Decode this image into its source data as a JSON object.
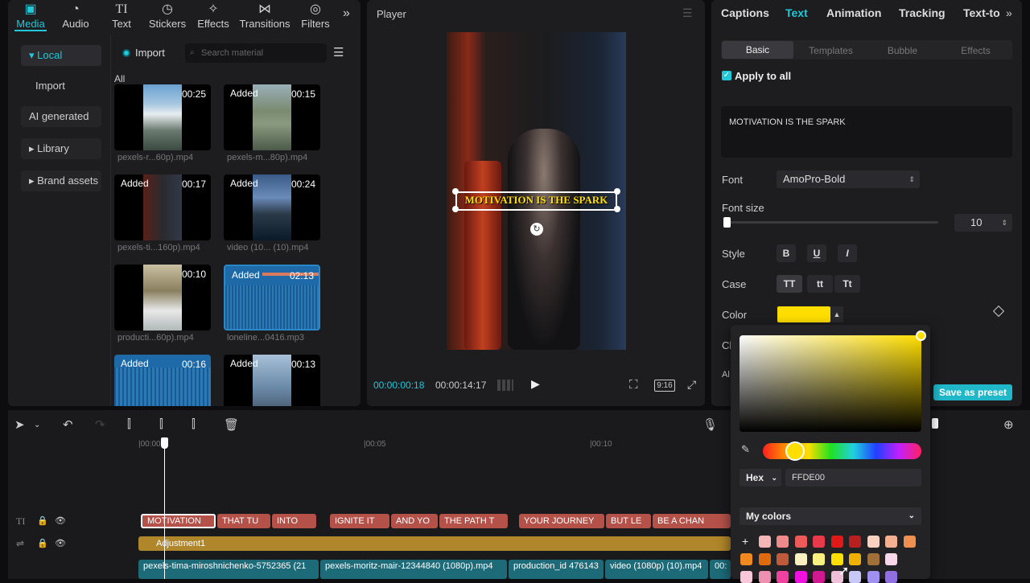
{
  "toolbar": {
    "tabs": [
      {
        "label": "Media",
        "icon": "media-icon"
      },
      {
        "label": "Audio",
        "icon": "audio-icon"
      },
      {
        "label": "Text",
        "icon": "text-icon"
      },
      {
        "label": "Stickers",
        "icon": "stickers-icon"
      },
      {
        "label": "Effects",
        "icon": "effects-icon"
      },
      {
        "label": "Transitions",
        "icon": "transitions-icon"
      },
      {
        "label": "Filters",
        "icon": "filters-icon"
      }
    ],
    "more": "»"
  },
  "sidebar": {
    "items": [
      {
        "label": "▾ Local"
      },
      {
        "label": "Import"
      },
      {
        "label": "AI generated"
      },
      {
        "label": "▸ Library"
      },
      {
        "label": "▸ Brand assets"
      }
    ]
  },
  "media": {
    "import_label": "Import",
    "search_placeholder": "Search material",
    "all_label": "All",
    "items": [
      {
        "badge": "",
        "duration": "00:25",
        "name": "pexels-r...60p).mp4"
      },
      {
        "badge": "Added",
        "duration": "00:15",
        "name": "pexels-m...80p).mp4"
      },
      {
        "badge": "Added",
        "duration": "00:17",
        "name": "pexels-ti...160p).mp4"
      },
      {
        "badge": "Added",
        "duration": "00:24",
        "name": "video (10... (10).mp4"
      },
      {
        "badge": "",
        "duration": "00:10",
        "name": "producti...60p).mp4"
      },
      {
        "badge": "Added",
        "duration": "02:13",
        "name": "loneline...0416.mp3"
      },
      {
        "badge": "Added",
        "duration": "00:16",
        "name": ""
      },
      {
        "badge": "Added",
        "duration": "00:13",
        "name": ""
      }
    ]
  },
  "player": {
    "title": "Player",
    "caption": "MOTIVATION IS THE SPARK",
    "current_time": "00:00:00:18",
    "total_time": "00:00:14:17",
    "ratio": "9:16"
  },
  "inspector": {
    "tabs": [
      "Captions",
      "Text",
      "Animation",
      "Tracking",
      "Text-to"
    ],
    "subtabs": [
      "Basic",
      "Templates",
      "Bubble",
      "Effects"
    ],
    "apply_all": "Apply to all",
    "text_value": "MOTIVATION IS THE SPARK",
    "font_label": "Font",
    "font_value": "AmoPro-Bold",
    "font_size_label": "Font size",
    "font_size_value": "10",
    "style_label": "Style",
    "style_buttons": [
      "B",
      "U",
      "I"
    ],
    "case_label": "Case",
    "case_buttons": [
      "TT",
      "tt",
      "Tt"
    ],
    "color_label": "Color",
    "color_value": "#FFDE00",
    "cut_labels": [
      "Cl",
      "Al"
    ],
    "save_preset": "Save as preset"
  },
  "color_picker": {
    "mode": "Hex",
    "hex": "FFDE00",
    "my_colors": "My colors",
    "add": "+",
    "swatches_row1": [
      "#f4b6b6",
      "#f08a8a",
      "#ec5a5a",
      "#e83a4a",
      "#e01818",
      "#b82020",
      "#f8d2c0",
      "#f4b090",
      "#f09050"
    ],
    "swatches_row2": [
      "#f08a20",
      "#e06a10",
      "#c05a3a",
      "#f8f0c0",
      "#f8f080",
      "#ffde00",
      "#f0b000",
      "#a07038",
      "#f8d8e8"
    ],
    "swatches_row3": [
      "#f8c8d8",
      "#f090b0",
      "#f040a0",
      "#f010e0",
      "#d01890",
      "#f0c0d8",
      "#c8c8f8",
      "#a090f0",
      "#9070e0"
    ]
  },
  "timeline": {
    "ticks": [
      "|00:00",
      "|00:05",
      "|00:10"
    ],
    "text_clips": [
      "MOTIVATION",
      "THAT TU",
      "INTO",
      "IGNITE IT",
      "AND YO",
      "THE PATH T",
      "YOUR JOURNEY",
      "BUT LE",
      "BE A CHAN"
    ],
    "adjustment": "Adjustment1",
    "video_clips": [
      "pexels-tima-miroshnichenko-5752365 (21",
      "pexels-moritz-mair-12344840 (1080p).mp4",
      "production_id 476143",
      "video (1080p) (10).mp4",
      "00:"
    ]
  }
}
